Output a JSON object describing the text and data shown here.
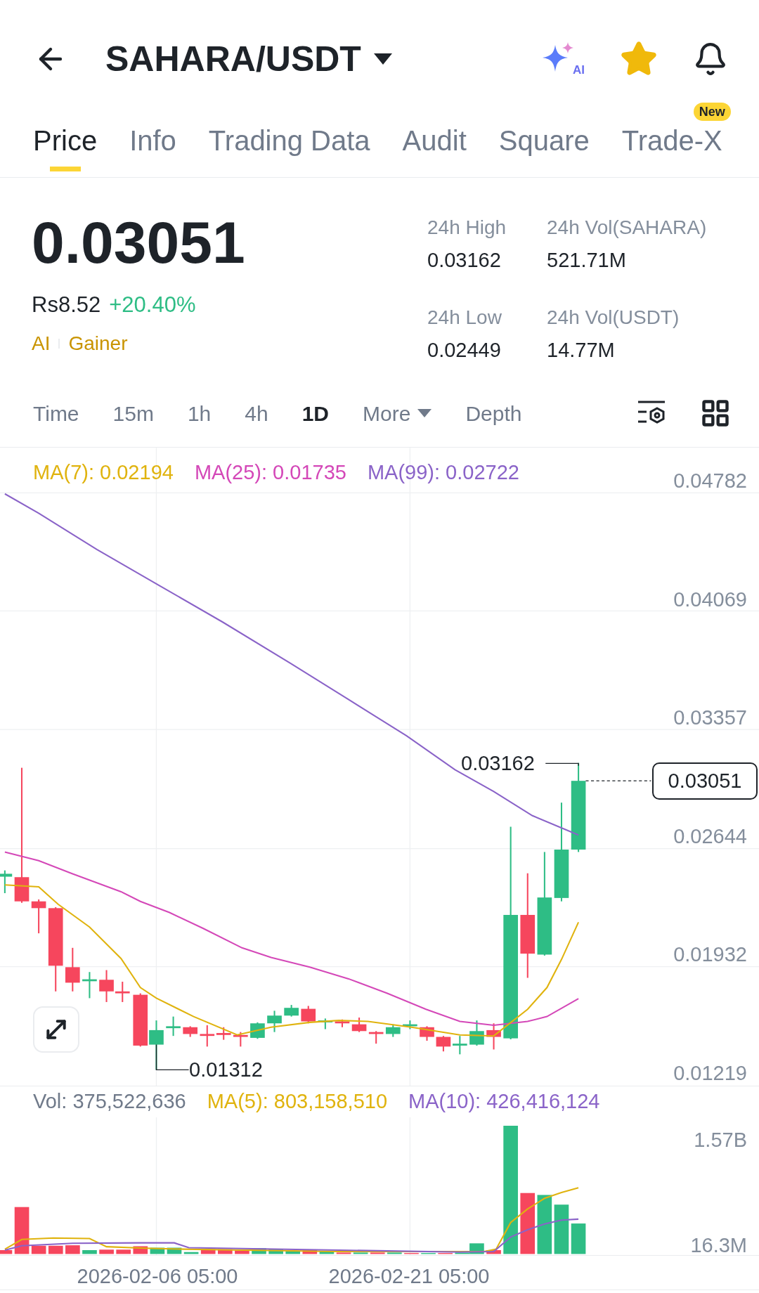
{
  "header": {
    "title": "SAHARA/USDT",
    "ai_label": "AI"
  },
  "tabs": [
    {
      "label": "Price",
      "selected": true
    },
    {
      "label": "Info",
      "selected": false
    },
    {
      "label": "Trading Data",
      "selected": false
    },
    {
      "label": "Audit",
      "selected": false
    },
    {
      "label": "Square",
      "selected": false
    },
    {
      "label": "Trade-X",
      "selected": false,
      "badge": "New"
    }
  ],
  "price": {
    "last": "0.03051",
    "fiat": "Rs8.52",
    "change": "+20.40%",
    "tags": [
      "AI",
      "Gainer"
    ]
  },
  "stats": [
    {
      "label": "24h High",
      "value": "0.03162"
    },
    {
      "label": "24h Vol(SAHARA)",
      "value": "521.71M"
    },
    {
      "label": "24h Low",
      "value": "0.02449"
    },
    {
      "label": "24h Vol(USDT)",
      "value": "14.77M"
    }
  ],
  "intervals": [
    {
      "label": "Time",
      "selected": false,
      "kind": "plain"
    },
    {
      "label": "15m",
      "selected": false,
      "kind": "plain"
    },
    {
      "label": "1h",
      "selected": false,
      "kind": "plain"
    },
    {
      "label": "4h",
      "selected": false,
      "kind": "plain"
    },
    {
      "label": "1D",
      "selected": true,
      "kind": "plain"
    },
    {
      "label": "More",
      "selected": false,
      "kind": "dropdown"
    },
    {
      "label": "Depth",
      "selected": false,
      "kind": "plain"
    }
  ],
  "price_chart": {
    "indicators": [
      {
        "text": "MA(7): 0.02194",
        "color": "#e0b30e"
      },
      {
        "text": "MA(25): 0.01735",
        "color": "#d448b8"
      },
      {
        "text": "MA(99): 0.02722",
        "color": "#8a63c8"
      }
    ],
    "y_labels": [
      "0.04782",
      "0.04069",
      "0.03357",
      "0.02644",
      "0.01932",
      "0.01219"
    ],
    "high_marker": "0.03162",
    "low_marker": "0.01312",
    "last_price": "0.03051"
  },
  "volume_chart": {
    "indicators": [
      {
        "text": "Vol: 375,522,636",
        "color": "#707a8a"
      },
      {
        "text": "MA(5): 803,158,510",
        "color": "#e0b30e"
      },
      {
        "text": "MA(10): 426,416,124",
        "color": "#8a63c8"
      }
    ],
    "y_labels": [
      "1.57B",
      "16.3M"
    ],
    "x_labels": [
      "2026-02-06 05:00",
      "2026-02-21 05:00"
    ]
  }
}
